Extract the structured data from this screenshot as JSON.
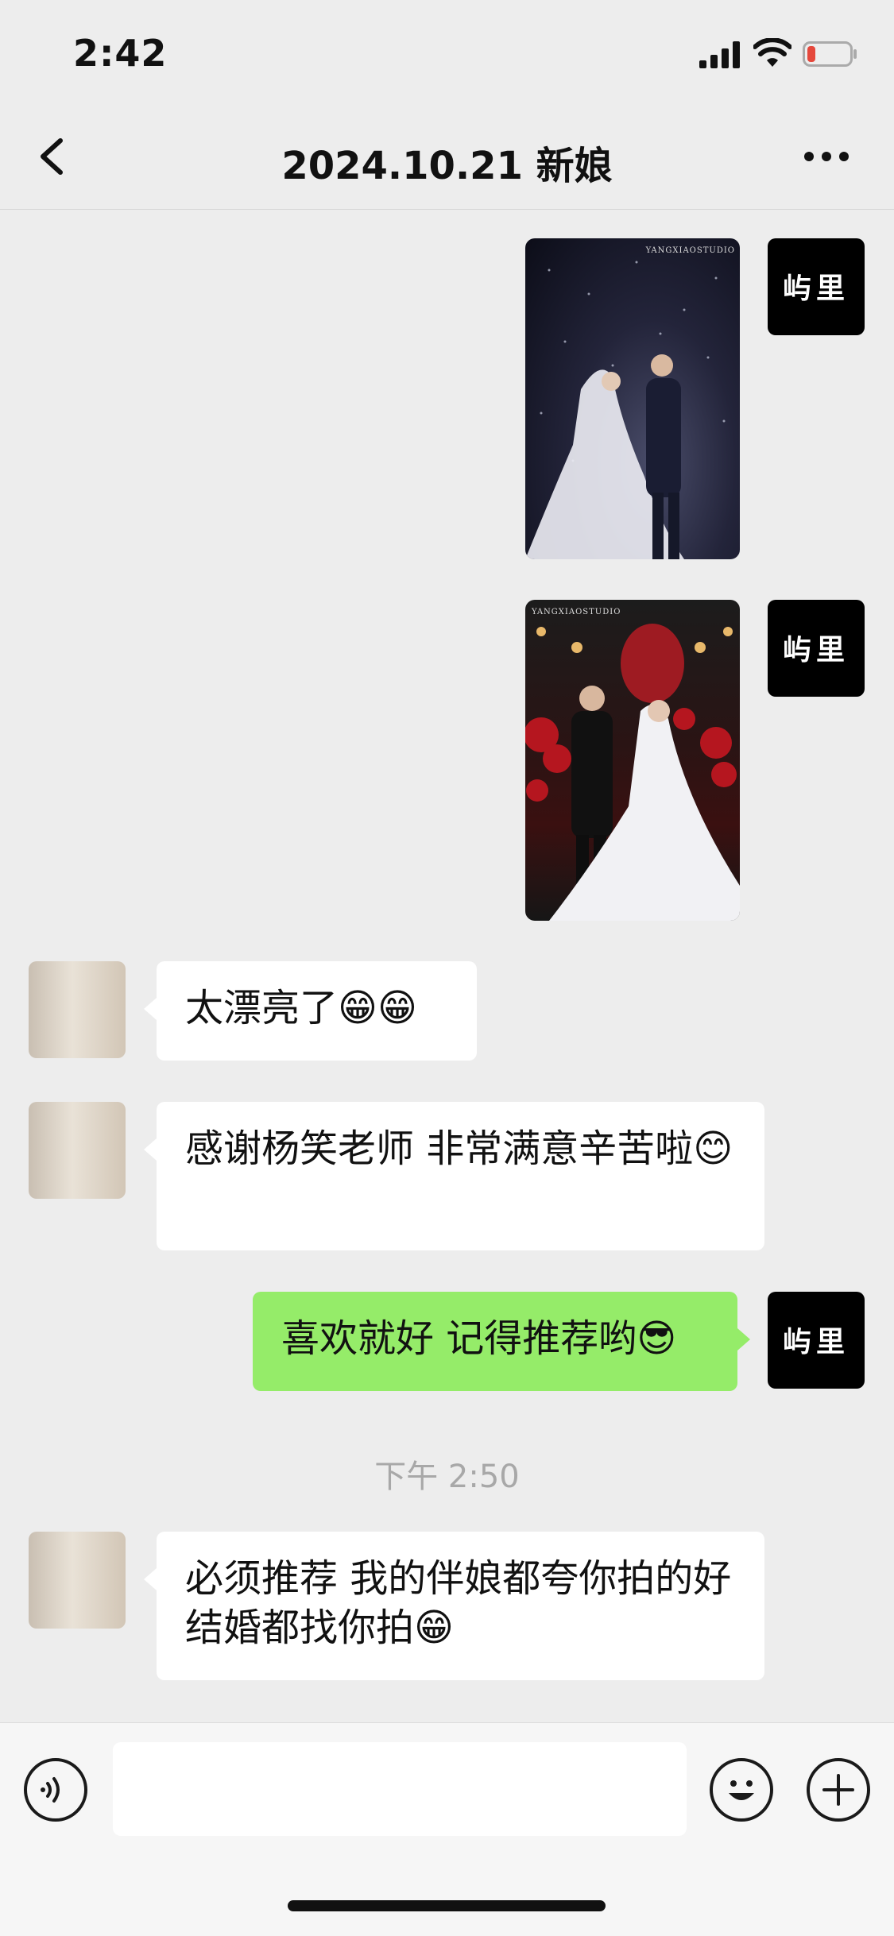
{
  "status": {
    "time": "2:42"
  },
  "nav": {
    "title": "2024.10.21 新娘"
  },
  "studio": {
    "logo_text": "屿里"
  },
  "photos": [
    {
      "watermark": "YANGXIAOSTUDIO"
    },
    {
      "watermark": "YANGXIAOSTUDIO"
    }
  ],
  "messages": [
    {
      "from": "user",
      "text": "太漂亮了😁😁"
    },
    {
      "from": "user",
      "text": "感谢杨笑老师  非常满意辛苦啦😊"
    },
    {
      "from": "studio",
      "text": "喜欢就好 记得推荐哟😎"
    },
    {
      "from": "user",
      "text": "必须推荐  我的伴娘都夸你拍的好  结婚都找你拍😁"
    }
  ],
  "timestamp": "下午 2:50",
  "colors": {
    "background": "#ededed",
    "out_bubble": "#95ec69",
    "in_bubble": "#ffffff",
    "battery_low": "#e5483c"
  },
  "icons": [
    "back-arrow-icon",
    "more-icon",
    "voice-icon",
    "emoji-icon",
    "plus-icon"
  ]
}
